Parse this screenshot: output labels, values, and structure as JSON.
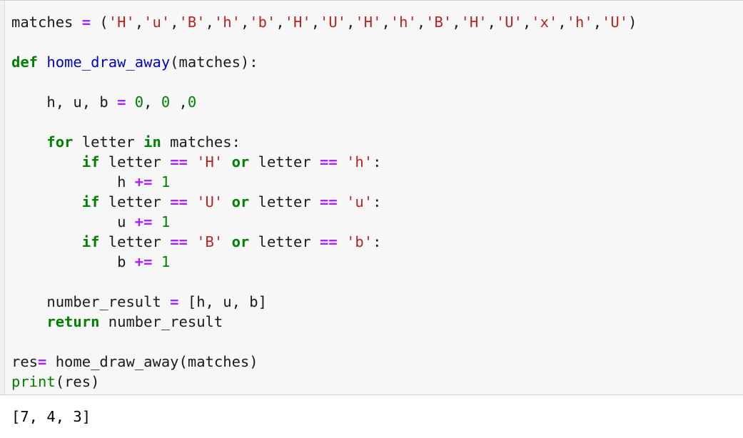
{
  "notebook": {
    "cell": {
      "kind": "code-cell",
      "language": "python",
      "background_color": "#f7f7f7",
      "border_color": "#cfcfcf",
      "lines": [
        {
          "id": "line-matches-assign",
          "tokens": [
            {
              "t": "plain",
              "s": "matches "
            },
            {
              "t": "op",
              "s": "="
            },
            {
              "t": "punct",
              "s": " ("
            },
            {
              "t": "str",
              "s": "'H'"
            },
            {
              "t": "punct",
              "s": ","
            },
            {
              "t": "str",
              "s": "'u'"
            },
            {
              "t": "punct",
              "s": ","
            },
            {
              "t": "str",
              "s": "'B'"
            },
            {
              "t": "punct",
              "s": ","
            },
            {
              "t": "str",
              "s": "'h'"
            },
            {
              "t": "punct",
              "s": ","
            },
            {
              "t": "str",
              "s": "'b'"
            },
            {
              "t": "punct",
              "s": ","
            },
            {
              "t": "str",
              "s": "'H'"
            },
            {
              "t": "punct",
              "s": ","
            },
            {
              "t": "str",
              "s": "'U'"
            },
            {
              "t": "punct",
              "s": ","
            },
            {
              "t": "str",
              "s": "'H'"
            },
            {
              "t": "punct",
              "s": ","
            },
            {
              "t": "str",
              "s": "'h'"
            },
            {
              "t": "punct",
              "s": ","
            },
            {
              "t": "str",
              "s": "'B'"
            },
            {
              "t": "punct",
              "s": ","
            },
            {
              "t": "str",
              "s": "'H'"
            },
            {
              "t": "punct",
              "s": ","
            },
            {
              "t": "str",
              "s": "'U'"
            },
            {
              "t": "punct",
              "s": ","
            },
            {
              "t": "str",
              "s": "'x'"
            },
            {
              "t": "punct",
              "s": ","
            },
            {
              "t": "str",
              "s": "'h'"
            },
            {
              "t": "punct",
              "s": ","
            },
            {
              "t": "str",
              "s": "'U'"
            },
            {
              "t": "punct",
              "s": ")"
            }
          ]
        },
        {
          "id": "line-blank-1",
          "tokens": []
        },
        {
          "id": "line-def-home-draw-away",
          "tokens": [
            {
              "t": "kw",
              "s": "def"
            },
            {
              "t": "plain",
              "s": " "
            },
            {
              "t": "fname",
              "s": "home_draw_away"
            },
            {
              "t": "punct",
              "s": "("
            },
            {
              "t": "plain",
              "s": "matches"
            },
            {
              "t": "punct",
              "s": "):"
            }
          ]
        },
        {
          "id": "line-blank-2",
          "tokens": []
        },
        {
          "id": "line-init-counters",
          "tokens": [
            {
              "t": "plain",
              "s": "    h, u, b "
            },
            {
              "t": "op",
              "s": "="
            },
            {
              "t": "plain",
              "s": " "
            },
            {
              "t": "num",
              "s": "0"
            },
            {
              "t": "punct",
              "s": ", "
            },
            {
              "t": "num",
              "s": "0"
            },
            {
              "t": "punct",
              "s": " ,"
            },
            {
              "t": "num",
              "s": "0"
            }
          ]
        },
        {
          "id": "line-blank-3",
          "tokens": []
        },
        {
          "id": "line-for-letter",
          "tokens": [
            {
              "t": "plain",
              "s": "    "
            },
            {
              "t": "kw",
              "s": "for"
            },
            {
              "t": "plain",
              "s": " letter "
            },
            {
              "t": "kw",
              "s": "in"
            },
            {
              "t": "plain",
              "s": " matches:"
            }
          ]
        },
        {
          "id": "line-if-home",
          "tokens": [
            {
              "t": "plain",
              "s": "        "
            },
            {
              "t": "kw",
              "s": "if"
            },
            {
              "t": "plain",
              "s": " letter "
            },
            {
              "t": "op",
              "s": "=="
            },
            {
              "t": "plain",
              "s": " "
            },
            {
              "t": "str",
              "s": "'H'"
            },
            {
              "t": "plain",
              "s": " "
            },
            {
              "t": "kw",
              "s": "or"
            },
            {
              "t": "plain",
              "s": " letter "
            },
            {
              "t": "op",
              "s": "=="
            },
            {
              "t": "plain",
              "s": " "
            },
            {
              "t": "str",
              "s": "'h'"
            },
            {
              "t": "punct",
              "s": ":"
            }
          ]
        },
        {
          "id": "line-incr-h",
          "tokens": [
            {
              "t": "plain",
              "s": "            h "
            },
            {
              "t": "op",
              "s": "+="
            },
            {
              "t": "plain",
              "s": " "
            },
            {
              "t": "num",
              "s": "1"
            }
          ]
        },
        {
          "id": "line-if-draw",
          "tokens": [
            {
              "t": "plain",
              "s": "        "
            },
            {
              "t": "kw",
              "s": "if"
            },
            {
              "t": "plain",
              "s": " letter "
            },
            {
              "t": "op",
              "s": "=="
            },
            {
              "t": "plain",
              "s": " "
            },
            {
              "t": "str",
              "s": "'U'"
            },
            {
              "t": "plain",
              "s": " "
            },
            {
              "t": "kw",
              "s": "or"
            },
            {
              "t": "plain",
              "s": " letter "
            },
            {
              "t": "op",
              "s": "=="
            },
            {
              "t": "plain",
              "s": " "
            },
            {
              "t": "str",
              "s": "'u'"
            },
            {
              "t": "punct",
              "s": ":"
            }
          ]
        },
        {
          "id": "line-incr-u",
          "tokens": [
            {
              "t": "plain",
              "s": "            u "
            },
            {
              "t": "op",
              "s": "+="
            },
            {
              "t": "plain",
              "s": " "
            },
            {
              "t": "num",
              "s": "1"
            }
          ]
        },
        {
          "id": "line-if-away",
          "tokens": [
            {
              "t": "plain",
              "s": "        "
            },
            {
              "t": "kw",
              "s": "if"
            },
            {
              "t": "plain",
              "s": " letter "
            },
            {
              "t": "op",
              "s": "=="
            },
            {
              "t": "plain",
              "s": " "
            },
            {
              "t": "str",
              "s": "'B'"
            },
            {
              "t": "plain",
              "s": " "
            },
            {
              "t": "kw",
              "s": "or"
            },
            {
              "t": "plain",
              "s": " letter "
            },
            {
              "t": "op",
              "s": "=="
            },
            {
              "t": "plain",
              "s": " "
            },
            {
              "t": "str",
              "s": "'b'"
            },
            {
              "t": "punct",
              "s": ":"
            }
          ]
        },
        {
          "id": "line-incr-b",
          "tokens": [
            {
              "t": "plain",
              "s": "            b "
            },
            {
              "t": "op",
              "s": "+="
            },
            {
              "t": "plain",
              "s": " "
            },
            {
              "t": "num",
              "s": "1"
            }
          ]
        },
        {
          "id": "line-blank-4",
          "tokens": []
        },
        {
          "id": "line-number-result",
          "tokens": [
            {
              "t": "plain",
              "s": "    number_result "
            },
            {
              "t": "op",
              "s": "="
            },
            {
              "t": "punct",
              "s": " ["
            },
            {
              "t": "plain",
              "s": "h, u, b"
            },
            {
              "t": "punct",
              "s": "]"
            }
          ]
        },
        {
          "id": "line-return",
          "tokens": [
            {
              "t": "plain",
              "s": "    "
            },
            {
              "t": "kw",
              "s": "return"
            },
            {
              "t": "plain",
              "s": " number_result"
            }
          ]
        },
        {
          "id": "line-blank-5",
          "tokens": []
        },
        {
          "id": "line-res-call",
          "tokens": [
            {
              "t": "plain",
              "s": "res"
            },
            {
              "t": "op",
              "s": "="
            },
            {
              "t": "plain",
              "s": " home_draw_away"
            },
            {
              "t": "punct",
              "s": "("
            },
            {
              "t": "plain",
              "s": "matches"
            },
            {
              "t": "punct",
              "s": ")"
            }
          ]
        },
        {
          "id": "line-print-res",
          "tokens": [
            {
              "t": "builtin",
              "s": "print"
            },
            {
              "t": "punct",
              "s": "("
            },
            {
              "t": "plain",
              "s": "res"
            },
            {
              "t": "punct",
              "s": ")"
            }
          ]
        }
      ]
    },
    "output": {
      "lines": [
        "[7, 4, 3]"
      ]
    }
  },
  "colors": {
    "keyword": "#008000",
    "builtin": "#008000",
    "function_name": "#0000cf",
    "string": "#ba2121",
    "number": "#008000",
    "operator": "#aa22ff",
    "plain": "#1a1a1a",
    "cell_background": "#f7f7f7",
    "page_background": "#ffffff"
  }
}
